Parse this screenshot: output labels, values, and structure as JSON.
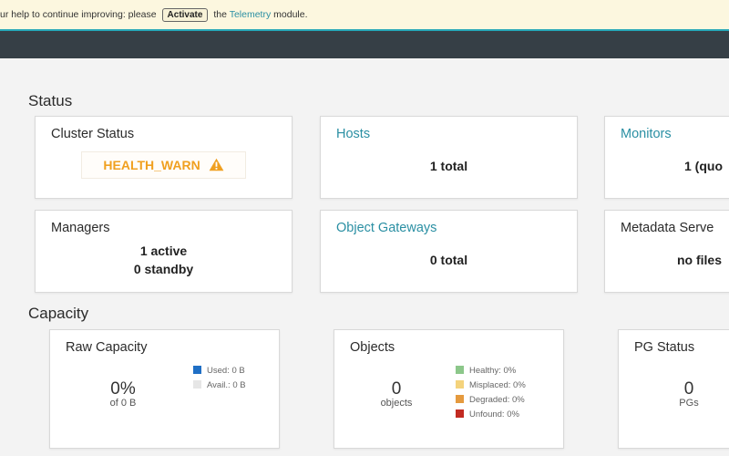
{
  "banner": {
    "text_before": "ur help to continue improving: please",
    "activate_label": "Activate",
    "text_mid": "the",
    "telemetry_link": "Telemetry",
    "text_after": "module."
  },
  "status": {
    "title": "Status",
    "cluster_status": {
      "title": "Cluster Status",
      "health": "HEALTH_WARN",
      "health_color": "#f0a020",
      "icon": "warning-triangle-icon"
    },
    "hosts": {
      "title": "Hosts",
      "value": "1 total"
    },
    "monitors": {
      "title": "Monitors",
      "value": "1 (quo"
    },
    "managers": {
      "title": "Managers",
      "active": "1 active",
      "standby": "0 standby"
    },
    "object_gateways": {
      "title": "Object Gateways",
      "value": "0 total"
    },
    "metadata_servers": {
      "title": "Metadata Serve",
      "value": "no files"
    }
  },
  "capacity": {
    "title": "Capacity",
    "raw_capacity": {
      "title": "Raw Capacity",
      "percent": "0%",
      "sub": "of 0 B",
      "legend": [
        {
          "label": "Used: 0 B",
          "color": "#1f6fc5"
        },
        {
          "label": "Avail.: 0 B",
          "color": "#e6e6e6"
        }
      ]
    },
    "objects": {
      "title": "Objects",
      "count": "0",
      "sub": "objects",
      "legend": [
        {
          "label": "Healthy: 0%",
          "color": "#8cc78a"
        },
        {
          "label": "Misplaced: 0%",
          "color": "#f4d37c"
        },
        {
          "label": "Degraded: 0%",
          "color": "#e59a3e"
        },
        {
          "label": "Unfound: 0%",
          "color": "#c22b22"
        }
      ]
    },
    "pg_status": {
      "title": "PG Status",
      "count": "0",
      "sub": "PGs"
    }
  },
  "colors": {
    "accent": "#2a8fa3",
    "navbar": "#363f46",
    "navbar_border": "#27a8b8",
    "banner_bg": "#fcf7df"
  }
}
